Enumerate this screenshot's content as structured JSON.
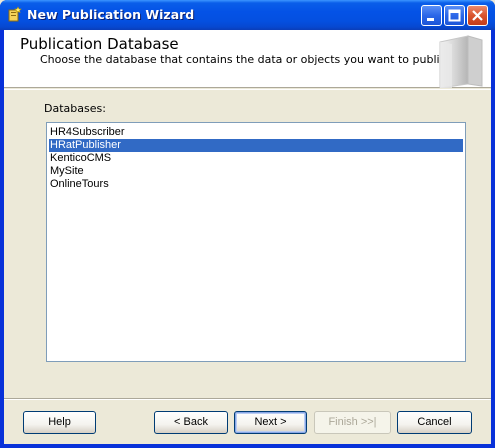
{
  "window": {
    "title": "New Publication Wizard"
  },
  "header": {
    "title": "Publication Database",
    "subtitle": "Choose the database that contains the data or objects you want to publish."
  },
  "databases": {
    "label": "Databases:",
    "items": [
      {
        "label": "HR4Subscriber",
        "selected": false
      },
      {
        "label": "HRatPublisher",
        "selected": true
      },
      {
        "label": "KenticoCMS",
        "selected": false
      },
      {
        "label": "MySite",
        "selected": false
      },
      {
        "label": "OnlineTours",
        "selected": false
      }
    ]
  },
  "buttons": {
    "help": "Help",
    "back": "< Back",
    "next": "Next >",
    "finish": "Finish >>|",
    "cancel": "Cancel"
  },
  "colors": {
    "titlebar": "#0054e3",
    "selection": "#316ac5",
    "dialog_bg": "#ece9d8"
  }
}
